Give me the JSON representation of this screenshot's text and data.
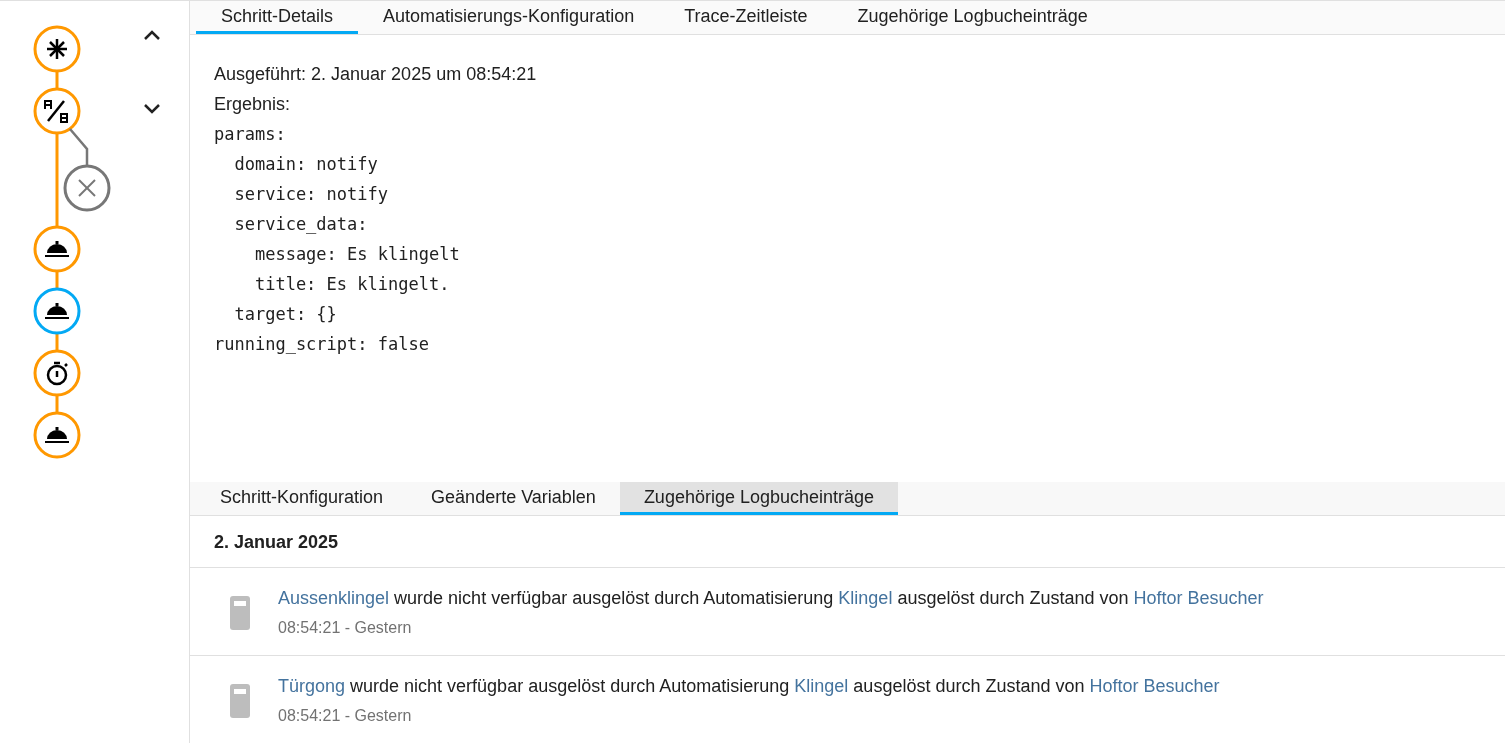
{
  "graph": {
    "nodes": [
      {
        "kind": "trigger",
        "selected": false
      },
      {
        "kind": "condition",
        "selected": false
      },
      {
        "kind": "skipped",
        "selected": false
      },
      {
        "kind": "action",
        "selected": false
      },
      {
        "kind": "action",
        "selected": true
      },
      {
        "kind": "delay",
        "selected": false
      },
      {
        "kind": "action",
        "selected": false
      }
    ]
  },
  "tabs": [
    {
      "label": "Schritt-Details",
      "selected": true
    },
    {
      "label": "Automatisierungs-Konfiguration",
      "selected": false
    },
    {
      "label": "Trace-Zeitleiste",
      "selected": false
    },
    {
      "label": "Zugehörige Logbucheinträge",
      "selected": false
    }
  ],
  "details": {
    "executed": "Ausgeführt: 2. Januar 2025 um 08:54:21",
    "result_label": "Ergebnis:",
    "result_lines": [
      "params:",
      "  domain: notify",
      "  service: notify",
      "  service_data:",
      "    message: Es klingelt",
      "    title: Es klingelt.",
      "  target: {}",
      "running_script: false"
    ]
  },
  "sub_tabs": [
    {
      "label": "Schritt-Konfiguration",
      "selected": false
    },
    {
      "label": "Geänderte Variablen",
      "selected": false
    },
    {
      "label": "Zugehörige Logbucheinträge",
      "selected": true
    }
  ],
  "logbook": {
    "date": "2. Januar 2025",
    "entries": [
      {
        "parts": [
          {
            "text": "Aussenklingel",
            "link": true
          },
          {
            "text": " wurde nicht verfügbar ausgelöst durch Automatisierung ",
            "link": false
          },
          {
            "text": "Klingel",
            "link": true
          },
          {
            "text": " ausgelöst durch Zustand von ",
            "link": false
          },
          {
            "text": "Hoftor Besucher",
            "link": true
          }
        ],
        "time": "08:54:21 - Gestern"
      },
      {
        "parts": [
          {
            "text": "Türgong",
            "link": true
          },
          {
            "text": " wurde nicht verfügbar ausgelöst durch Automatisierung ",
            "link": false
          },
          {
            "text": "Klingel",
            "link": true
          },
          {
            "text": " ausgelöst durch Zustand von ",
            "link": false
          },
          {
            "text": "Hoftor Besucher",
            "link": true
          }
        ],
        "time": "08:54:21 - Gestern"
      }
    ]
  }
}
